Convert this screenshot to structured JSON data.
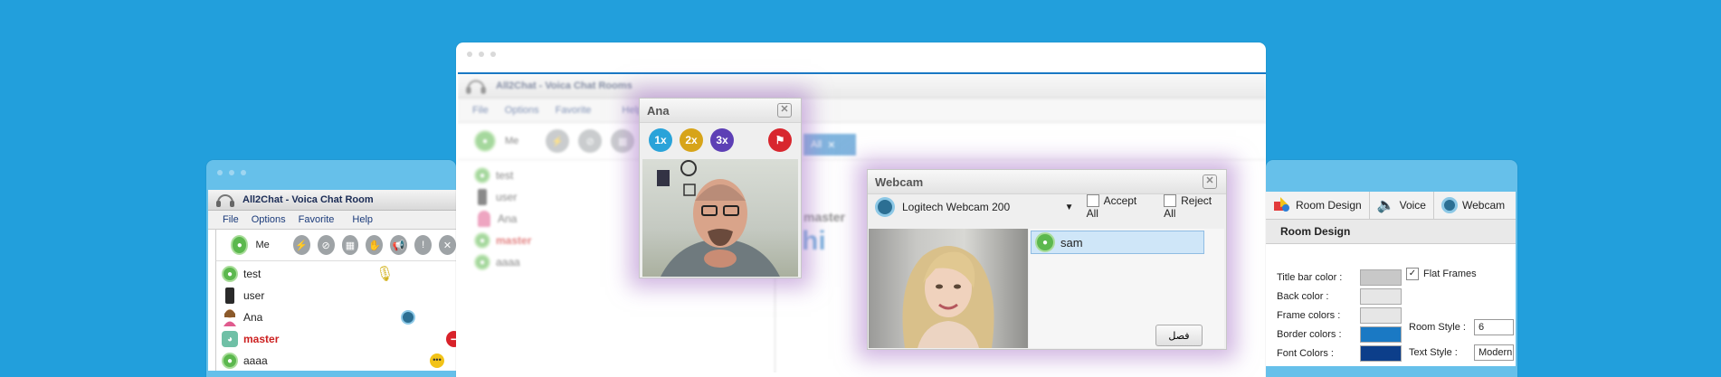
{
  "colors": {
    "background": "#229fdc",
    "accent": "#1a79c4",
    "master": "#cc1f1f",
    "flat_purple": "#9a78c6"
  },
  "left_window": {
    "title": "All2Chat - Voica Chat Room",
    "menu": [
      "File",
      "Options",
      "Favorite",
      "Help"
    ],
    "me_label": "Me",
    "users": [
      {
        "name": "test",
        "icon": "user-avatar-icon",
        "right_icon": "microphone-icon"
      },
      {
        "name": "user",
        "icon": "phone-device-icon",
        "right_icon": ""
      },
      {
        "name": "Ana",
        "icon": "female-avatar-icon",
        "right_icon": "webcam-icon"
      },
      {
        "name": "master",
        "icon": "admin-avatar-icon",
        "right_icon": "block-icon"
      },
      {
        "name": "aaaa",
        "icon": "user-avatar-icon",
        "right_icon": "chat-bubble-icon"
      }
    ]
  },
  "center_window": {
    "title": "All2Chat - Voica Chat Rooms",
    "menu": [
      "File",
      "Options",
      "Favorite",
      "Help"
    ],
    "me_label": "Me",
    "tab_label": "All",
    "users": [
      "test",
      "user",
      "Ana",
      "master",
      "aaaa"
    ],
    "chat_sender": "master",
    "chat_message": "hi"
  },
  "ana_dialog": {
    "title": "Ana",
    "zoom": [
      {
        "label": "1x",
        "color": "#29a3d9"
      },
      {
        "label": "2x",
        "color": "#d7a419"
      },
      {
        "label": "3x",
        "color": "#5d3fb5"
      }
    ],
    "flag": "flag-icon"
  },
  "webcam_dialog": {
    "title": "Webcam",
    "device": "Logitech Webcam 200",
    "accept_all": "Accept All",
    "reject_all": "Reject All",
    "viewer": "sam",
    "disconnect_button": "فصل"
  },
  "settings": {
    "tabs": [
      "Room Design",
      "Voice",
      "Webcam"
    ],
    "section": "Room Design",
    "rows": [
      {
        "label": "Title bar color :",
        "color": "#c8c8c8"
      },
      {
        "label": "Back color :",
        "color": "#e6e6e6"
      },
      {
        "label": "Frame colors :",
        "color": "#e6e6e6"
      },
      {
        "label": "Border colors :",
        "color": "#1a79c4"
      },
      {
        "label": "Font Colors :",
        "color": "#0c3e8a"
      }
    ],
    "flat_frames": "Flat Frames",
    "room_style_label": "Room Style :",
    "room_style_value": "6",
    "text_style_label": "Text Style :",
    "text_style_value": "Modern"
  }
}
